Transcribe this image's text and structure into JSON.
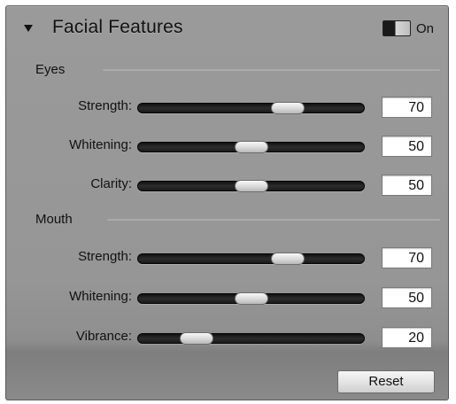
{
  "header": {
    "title": "Facial Features",
    "toggle_label": "On",
    "toggle_state": "on",
    "expanded": true
  },
  "eyes": {
    "label": "Eyes",
    "rows": [
      {
        "label": "Strength:",
        "value": "70",
        "slider_fraction": 0.7
      },
      {
        "label": "Whitening:",
        "value": "50",
        "slider_fraction": 0.5
      },
      {
        "label": "Clarity:",
        "value": "50",
        "slider_fraction": 0.5
      }
    ]
  },
  "mouth": {
    "label": "Mouth",
    "rows": [
      {
        "label": "Strength:",
        "value": "70",
        "slider_fraction": 0.7
      },
      {
        "label": "Whitening:",
        "value": "50",
        "slider_fraction": 0.5
      },
      {
        "label": "Vibrance:",
        "value": "20",
        "slider_fraction": 0.2
      }
    ]
  },
  "footer": {
    "reset_label": "Reset"
  },
  "colors": {
    "panel_bg": "#969696",
    "track": "#1a1a1a",
    "thumb": "#dcdcdc",
    "field_bg": "#ffffff"
  }
}
